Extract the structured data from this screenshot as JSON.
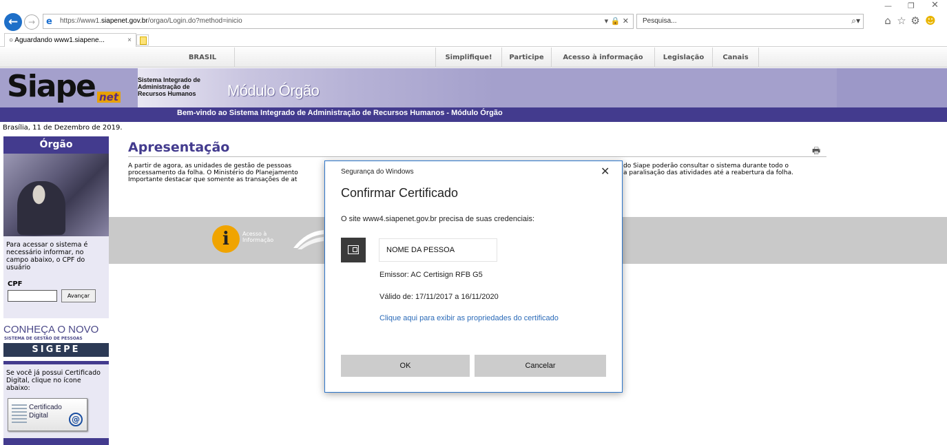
{
  "browser": {
    "url_prefix": "https://www1.",
    "url_domain": "siapenet.gov.br",
    "url_path": "/orgao/Login.do?method=inicio",
    "address_tools": "▾ 🔒 ✕",
    "search_placeholder": "Pesquisa...",
    "tab_title": "Aguardando www1.siapene...",
    "tab_close": "×"
  },
  "govbar": {
    "brasil": "BRASIL",
    "items": [
      "Simplifique!",
      "Participe",
      "Acesso à informação",
      "Legislação",
      "Canais"
    ]
  },
  "header": {
    "logo": "Siape",
    "logo_net": "net",
    "subtitle_1": "Sistema Integrado de",
    "subtitle_2": "Administração de",
    "subtitle_3": "Recursos Humanos",
    "module": "Módulo Órgão",
    "welcome": "Bem-vindo ao Sistema Integrado de Administração de Recursos Humanos - Módulo Órgão"
  },
  "date": "Brasília, 11 de Dezembro de 2019.",
  "sidebar": {
    "heading": "Órgão",
    "intro": "Para acessar o sistema é necessário informar, no campo abaixo, o CPF do usuário",
    "cpf_label": "CPF",
    "submit": "Avançar",
    "conheca": "CONHEÇA O NOVO",
    "conheca_sub": "SISTEMA DE GESTÃO DE PESSOAS",
    "sigepe": "SIGEPE",
    "cert_intro": "Se você já possui Certificado Digital, clique no ícone abaixo:",
    "cert_line1": "Certificado",
    "cert_line2": "Digital"
  },
  "main": {
    "title": "Apresentação",
    "p1_left": "A partir de agora, as unidades de gestão de pessoas",
    "p2_left": "processamento da folha. O Ministério do Planejamento",
    "p3_left": "Importante destacar que somente as transações de at",
    "p1_right": "do Siape poderão consultar o sistema durante todo o",
    "p2_right": "a paralisação das atividades até a reabertura da folha.",
    "acesso_1": "Acesso à",
    "acesso_2": "Informação"
  },
  "dialog": {
    "window_title": "Segurança do Windows",
    "heading": "Confirmar Certificado",
    "message": "O site www4.siapenet.gov.br precisa de suas credenciais:",
    "name": "NOME DA PESSOA",
    "issuer": "Emissor: AC Certisign RFB G5",
    "validity": "Válido de: 17/11/2017 a 16/11/2020",
    "link": "Clique aqui para exibir as propriedades do certificado",
    "ok": "OK",
    "cancel": "Cancelar"
  }
}
